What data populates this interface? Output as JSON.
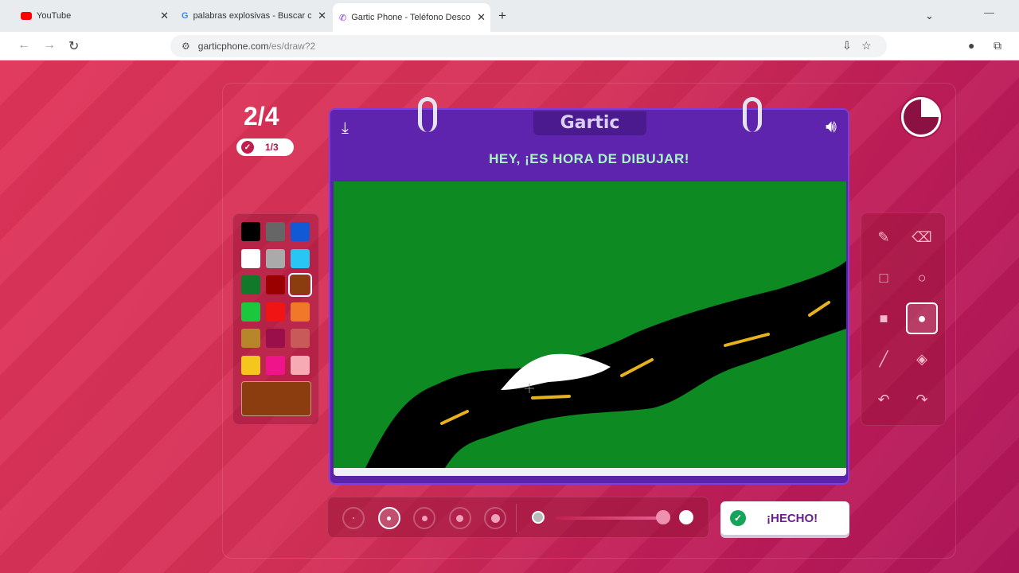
{
  "browser": {
    "tabs": [
      {
        "title": "YouTube",
        "icon": "youtube-icon"
      },
      {
        "title": "palabras explosivas - Buscar con",
        "icon": "google-icon"
      },
      {
        "title": "Gartic Phone - Teléfono Descon",
        "icon": "gartic-icon"
      }
    ],
    "url_host": "garticphone.com",
    "url_path": "/es/draw?2"
  },
  "game": {
    "round": "2/4",
    "submitted": "1/3",
    "logo": "Gartic",
    "prompt": "HEY, ¡ES HORA DE DIBUJAR!",
    "done_label": "¡HECHO!",
    "timer_remaining_fraction": 0.75
  },
  "palette": {
    "colors": [
      "#000000",
      "#666666",
      "#1259d6",
      "#ffffff",
      "#aaaaaa",
      "#28c6f5",
      "#117a2a",
      "#9a0000",
      "#8b3d10",
      "#19c83c",
      "#f01414",
      "#f07828",
      "#b8862a",
      "#9a0f4a",
      "#c85a5a",
      "#f5c61e",
      "#f0148a",
      "#f5aab4"
    ],
    "selected_index": 8,
    "current_color": "#8b3d10"
  },
  "tools": [
    "pencil",
    "eraser",
    "rectangle",
    "ellipse",
    "filled-rectangle",
    "filled-ellipse",
    "line",
    "fill-bucket",
    "undo",
    "redo"
  ],
  "selected_tool_index": 5,
  "brush_sizes": 5,
  "selected_brush_index": 1
}
